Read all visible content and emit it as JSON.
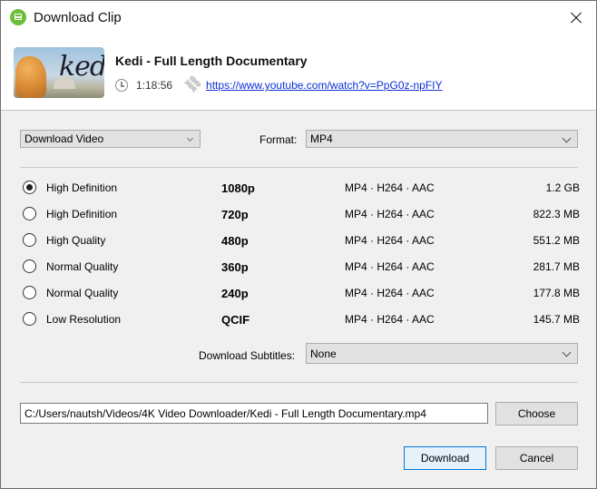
{
  "window": {
    "title": "Download Clip",
    "app_icon": "4k-video-downloader-icon",
    "close_icon": "close-icon"
  },
  "video": {
    "title": "Kedi - Full Length Documentary",
    "thumbnail_text": "kedi",
    "duration": "1:18:56",
    "url": "https://www.youtube.com/watch?v=PpG0z-npFIY"
  },
  "options": {
    "mode": "Download Video",
    "format_label": "Format:",
    "format": "MP4"
  },
  "qualities": [
    {
      "label": "High Definition",
      "resolution": "1080p",
      "codec": "MP4 · H264 · AAC",
      "size": "1.2 GB",
      "selected": true
    },
    {
      "label": "High Definition",
      "resolution": "720p",
      "codec": "MP4 · H264 · AAC",
      "size": "822.3 MB",
      "selected": false
    },
    {
      "label": "High Quality",
      "resolution": "480p",
      "codec": "MP4 · H264 · AAC",
      "size": "551.2 MB",
      "selected": false
    },
    {
      "label": "Normal Quality",
      "resolution": "360p",
      "codec": "MP4 · H264 · AAC",
      "size": "281.7 MB",
      "selected": false
    },
    {
      "label": "Normal Quality",
      "resolution": "240p",
      "codec": "MP4 · H264 · AAC",
      "size": "177.8 MB",
      "selected": false
    },
    {
      "label": "Low Resolution",
      "resolution": "QCIF",
      "codec": "MP4 · H264 · AAC",
      "size": "145.7 MB",
      "selected": false
    }
  ],
  "subtitles": {
    "label": "Download Subtitles:",
    "value": "None"
  },
  "output": {
    "path": "C:/Users/nautsh/Videos/4K Video Downloader/Kedi - Full Length Documentary.mp4",
    "choose_label": "Choose"
  },
  "actions": {
    "download_label": "Download",
    "cancel_label": "Cancel"
  },
  "colors": {
    "accent": "#0078d7",
    "link": "#0b2fd6",
    "app_icon": "#6bbf3a"
  }
}
